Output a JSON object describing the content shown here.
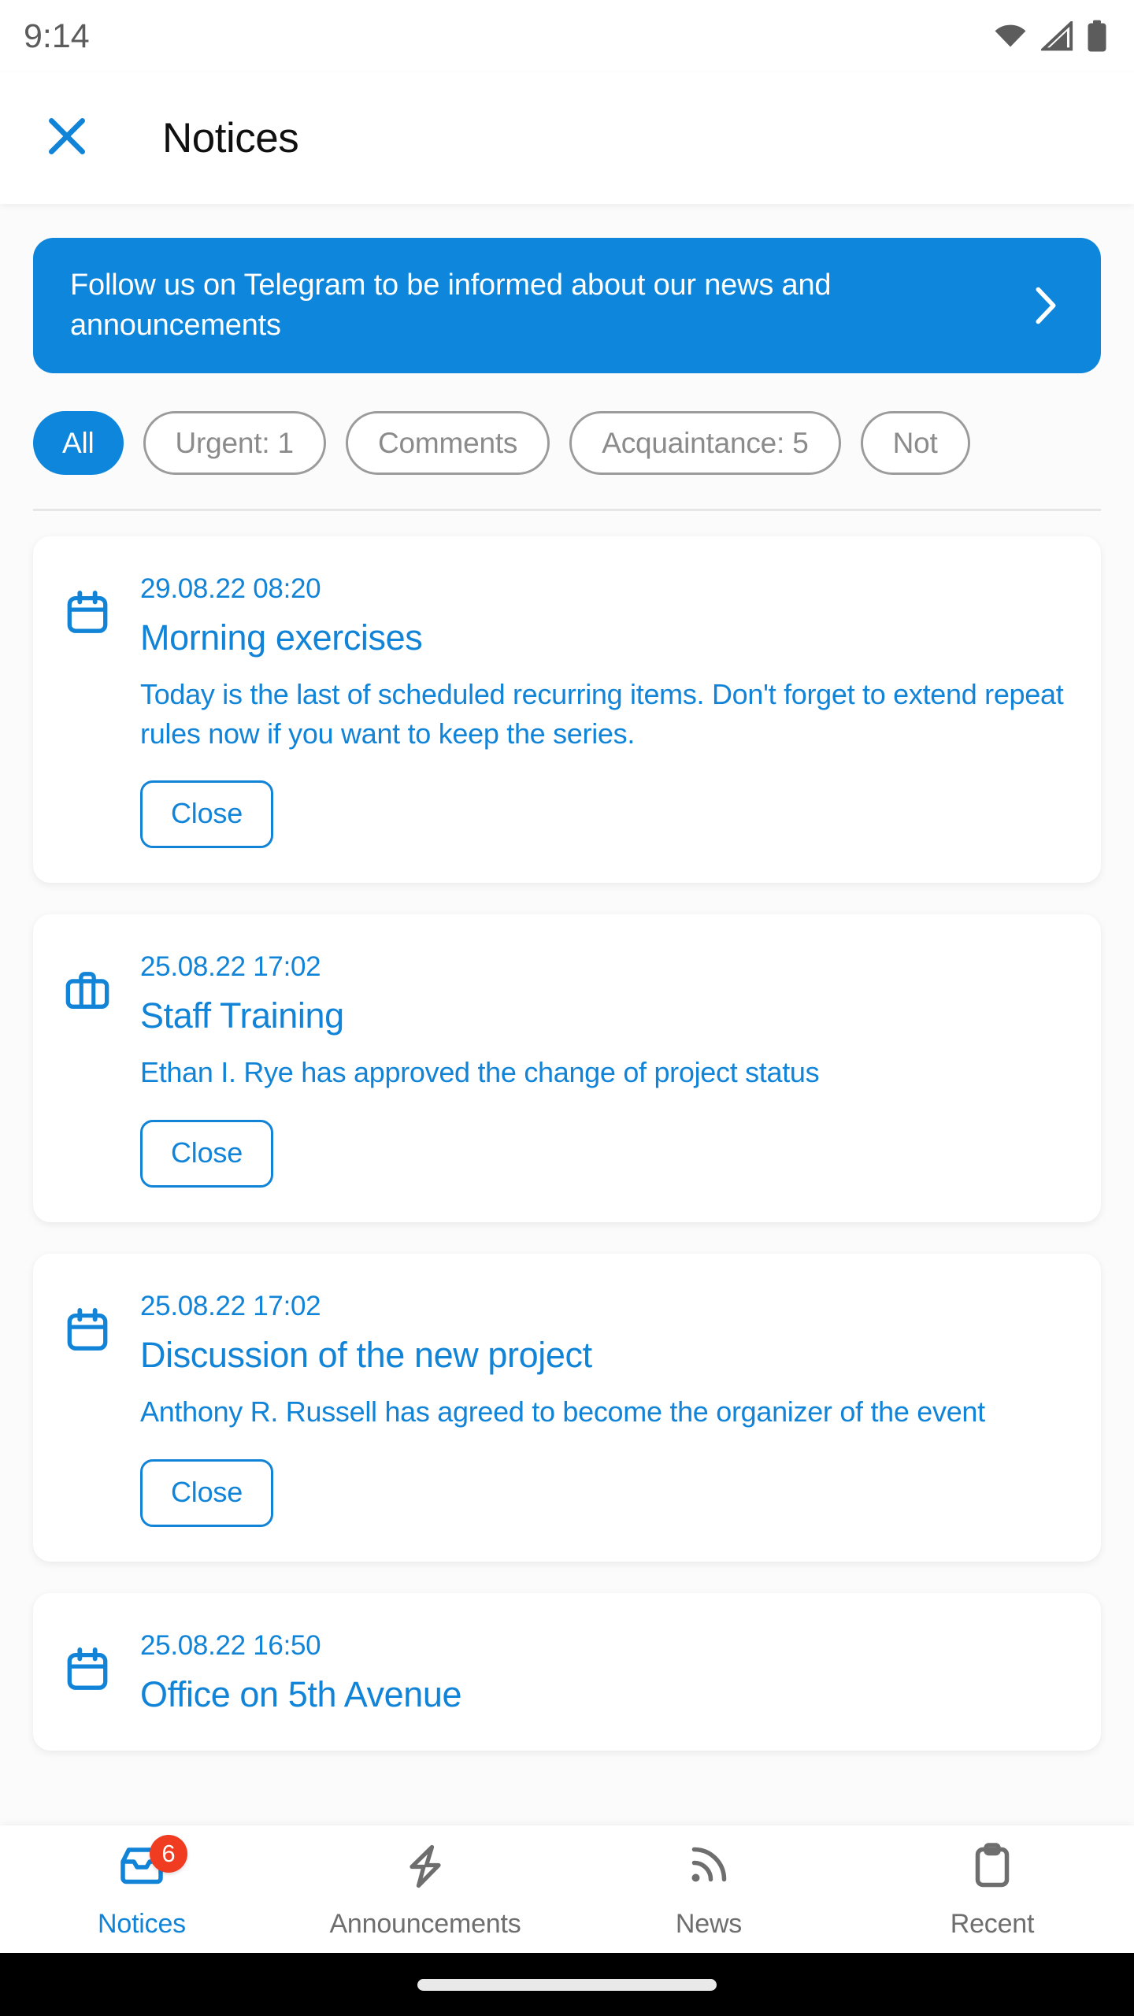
{
  "status_bar": {
    "time": "9:14",
    "icons": [
      "wifi-icon",
      "cellular-signal-icon",
      "battery-icon"
    ]
  },
  "header": {
    "close_icon": "close-icon",
    "title": "Notices"
  },
  "banner": {
    "text": "Follow us on Telegram to be informed about our news and announcements",
    "chevron_icon": "chevron-right-icon",
    "background_color": "#0d86dc",
    "text_color": "#ffffff"
  },
  "filters": {
    "active": "All",
    "chips": [
      {
        "label": "All",
        "active": true
      },
      {
        "label": "Urgent: 1",
        "active": false
      },
      {
        "label": "Comments",
        "active": false
      },
      {
        "label": "Acquaintance: 5",
        "active": false
      },
      {
        "label": "Not",
        "active": false
      }
    ]
  },
  "notices": [
    {
      "icon": "calendar-icon",
      "date": "29.08.22 08:20",
      "title": "Morning exercises",
      "body": "Today is the last of scheduled recurring items. Don't forget to extend repeat rules now if you want to keep the series.",
      "action_label": "Close"
    },
    {
      "icon": "briefcase-icon",
      "date": "25.08.22 17:02",
      "title": "Staff Training",
      "body": "Ethan I. Rye has approved the change of project status",
      "action_label": "Close"
    },
    {
      "icon": "calendar-icon",
      "date": "25.08.22 17:02",
      "title": "Discussion of the new project",
      "body": "Anthony R. Russell has agreed to become the organizer of the event",
      "action_label": "Close"
    },
    {
      "icon": "calendar-icon",
      "date": "25.08.22 16:50",
      "title": "Office on 5th Avenue",
      "body": "",
      "action_label": ""
    }
  ],
  "bottom_nav": {
    "items": [
      {
        "label": "Notices",
        "icon": "inbox-tray-icon",
        "active": true,
        "badge": "6"
      },
      {
        "label": "Announcements",
        "icon": "lightning-bolt-icon",
        "active": false,
        "badge": ""
      },
      {
        "label": "News",
        "icon": "rss-icon",
        "active": false,
        "badge": ""
      },
      {
        "label": "Recent",
        "icon": "clipboard-icon",
        "active": false,
        "badge": ""
      }
    ]
  },
  "colors": {
    "accent_blue": "#0d86dc",
    "link_blue": "#1184d8",
    "badge_red": "#f03c20",
    "muted_gray": "#8b8b8b",
    "title_black": "#101010"
  }
}
